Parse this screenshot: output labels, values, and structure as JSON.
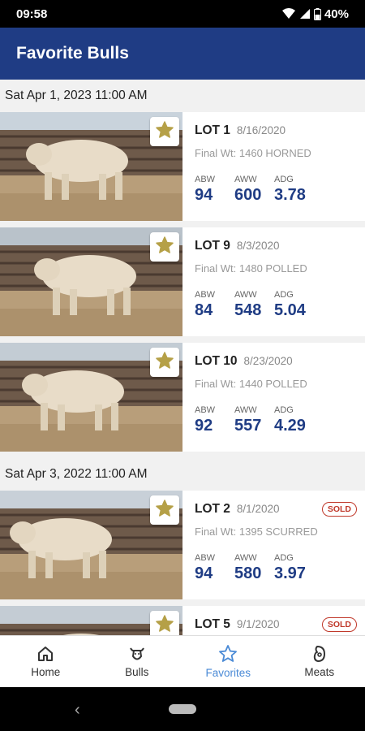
{
  "status": {
    "time": "09:58",
    "battery": "40%"
  },
  "app_bar": {
    "title": "Favorite Bulls"
  },
  "sections": [
    {
      "date": "Sat Apr 1, 2023 11:00 AM",
      "lots": [
        {
          "lot": "LOT 1",
          "date": "8/16/2020",
          "sub": "Final Wt: 1460  HORNED",
          "stats": [
            {
              "label": "ABW",
              "value": "94"
            },
            {
              "label": "AWW",
              "value": "600"
            },
            {
              "label": "ADG",
              "value": "3.78"
            }
          ],
          "sold": ""
        },
        {
          "lot": "LOT 9",
          "date": "8/3/2020",
          "sub": "Final Wt: 1480  POLLED",
          "stats": [
            {
              "label": "ABW",
              "value": "84"
            },
            {
              "label": "AWW",
              "value": "548"
            },
            {
              "label": "ADG",
              "value": "5.04"
            }
          ],
          "sold": ""
        },
        {
          "lot": "LOT 10",
          "date": "8/23/2020",
          "sub": "Final Wt: 1440  POLLED",
          "stats": [
            {
              "label": "ABW",
              "value": "92"
            },
            {
              "label": "AWW",
              "value": "557"
            },
            {
              "label": "ADG",
              "value": "4.29"
            }
          ],
          "sold": ""
        }
      ]
    },
    {
      "date": "Sat Apr 3, 2022 11:00 AM",
      "lots": [
        {
          "lot": "LOT 2",
          "date": "8/1/2020",
          "sub": "Final Wt: 1395  SCURRED",
          "stats": [
            {
              "label": "ABW",
              "value": "94"
            },
            {
              "label": "AWW",
              "value": "580"
            },
            {
              "label": "ADG",
              "value": "3.97"
            }
          ],
          "sold": "SOLD"
        },
        {
          "lot": "LOT 5",
          "date": "9/1/2020",
          "sub": "",
          "stats": [],
          "sold": "SOLD"
        }
      ]
    }
  ],
  "bottom_nav": [
    {
      "label": "Home",
      "icon": "home-icon",
      "active": false
    },
    {
      "label": "Bulls",
      "icon": "bull-icon",
      "active": false
    },
    {
      "label": "Favorites",
      "icon": "star-icon",
      "active": true
    },
    {
      "label": "Meats",
      "icon": "meat-icon",
      "active": false
    }
  ],
  "colors": {
    "primary": "#1f3c84",
    "star": "#b5a047",
    "active_nav": "#4a8ad6",
    "sold": "#c0392b"
  }
}
